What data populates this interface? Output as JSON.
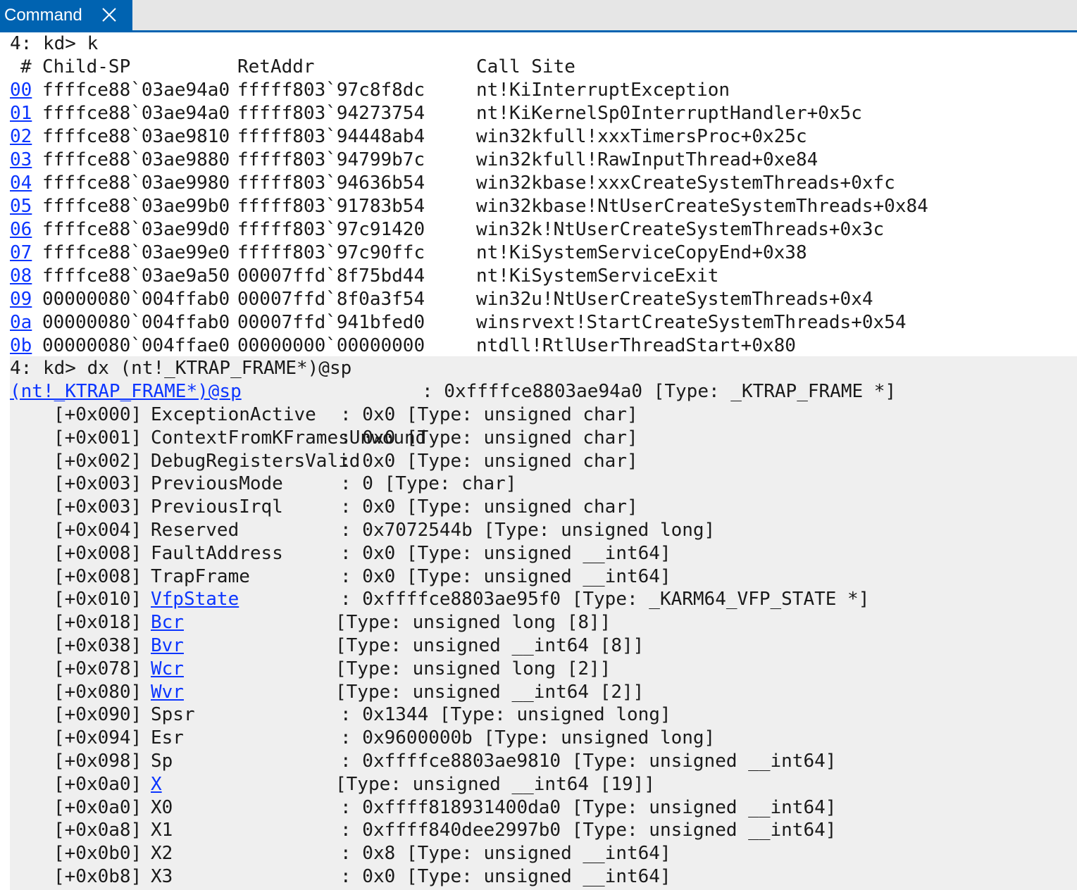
{
  "tab": {
    "label": "Command",
    "close_icon": "close-icon"
  },
  "stack": {
    "prompt": "4: kd> k",
    "headers": {
      "num": "#",
      "child_sp": "Child-SP",
      "ret_addr": "RetAddr",
      "call_site": "Call Site"
    },
    "frames": [
      {
        "num": "00",
        "child_sp": "ffffce88`03ae94a0",
        "ret_addr": "fffff803`97c8f8dc",
        "call_site": "nt!KiInterruptException"
      },
      {
        "num": "01",
        "child_sp": "ffffce88`03ae94a0",
        "ret_addr": "fffff803`94273754",
        "call_site": "nt!KiKernelSp0InterruptHandler+0x5c"
      },
      {
        "num": "02",
        "child_sp": "ffffce88`03ae9810",
        "ret_addr": "fffff803`94448ab4",
        "call_site": "win32kfull!xxxTimersProc+0x25c"
      },
      {
        "num": "03",
        "child_sp": "ffffce88`03ae9880",
        "ret_addr": "fffff803`94799b7c",
        "call_site": "win32kfull!RawInputThread+0xe84"
      },
      {
        "num": "04",
        "child_sp": "ffffce88`03ae9980",
        "ret_addr": "fffff803`94636b54",
        "call_site": "win32kbase!xxxCreateSystemThreads+0xfc"
      },
      {
        "num": "05",
        "child_sp": "ffffce88`03ae99b0",
        "ret_addr": "fffff803`91783b54",
        "call_site": "win32kbase!NtUserCreateSystemThreads+0x84"
      },
      {
        "num": "06",
        "child_sp": "ffffce88`03ae99d0",
        "ret_addr": "fffff803`97c91420",
        "call_site": "win32k!NtUserCreateSystemThreads+0x3c"
      },
      {
        "num": "07",
        "child_sp": "ffffce88`03ae99e0",
        "ret_addr": "fffff803`97c90ffc",
        "call_site": "nt!KiSystemServiceCopyEnd+0x38"
      },
      {
        "num": "08",
        "child_sp": "ffffce88`03ae9a50",
        "ret_addr": "00007ffd`8f75bd44",
        "call_site": "nt!KiSystemServiceExit"
      },
      {
        "num": "09",
        "child_sp": "00000080`004ffab0",
        "ret_addr": "00007ffd`8f0a3f54",
        "call_site": "win32u!NtUserCreateSystemThreads+0x4"
      },
      {
        "num": "0a",
        "child_sp": "00000080`004ffab0",
        "ret_addr": "00007ffd`941bfed0",
        "call_site": "winsrvext!StartCreateSystemThreads+0x54"
      },
      {
        "num": "0b",
        "child_sp": "00000080`004ffae0",
        "ret_addr": "00000000`00000000",
        "call_site": "ntdll!RtlUserThreadStart+0x80"
      }
    ]
  },
  "dx": {
    "prompt": "4: kd> dx (nt!_KTRAP_FRAME*)@sp",
    "root": {
      "expr": "(nt!_KTRAP_FRAME*)@sp",
      "value": ": 0xffffce8803ae94a0 [Type: _KTRAP_FRAME *]"
    },
    "fields": [
      {
        "offset": "[+0x000]",
        "name": "ExceptionActive",
        "link": false,
        "value": ": 0x0 [Type: unsigned char]"
      },
      {
        "offset": "[+0x001]",
        "name": "ContextFromKFramesUnwound",
        "link": false,
        "value": ": 0x0 [Type: unsigned char]"
      },
      {
        "offset": "[+0x002]",
        "name": "DebugRegistersValid",
        "link": false,
        "value": ": 0x0 [Type: unsigned char]"
      },
      {
        "offset": "[+0x003]",
        "name": "PreviousMode",
        "link": false,
        "value": ": 0 [Type: char]"
      },
      {
        "offset": "[+0x003]",
        "name": "PreviousIrql",
        "link": false,
        "value": ": 0x0 [Type: unsigned char]"
      },
      {
        "offset": "[+0x004]",
        "name": "Reserved",
        "link": false,
        "value": ": 0x7072544b [Type: unsigned long]"
      },
      {
        "offset": "[+0x008]",
        "name": "FaultAddress",
        "link": false,
        "value": ": 0x0 [Type: unsigned __int64]"
      },
      {
        "offset": "[+0x008]",
        "name": "TrapFrame",
        "link": false,
        "value": ": 0x0 [Type: unsigned __int64]"
      },
      {
        "offset": "[+0x010]",
        "name": "VfpState",
        "link": true,
        "value": ": 0xffffce8803ae95f0 [Type: _KARM64_VFP_STATE *]"
      },
      {
        "offset": "[+0x018]",
        "name": "Bcr",
        "link": true,
        "value": "[Type: unsigned long [8]]"
      },
      {
        "offset": "[+0x038]",
        "name": "Bvr",
        "link": true,
        "value": "[Type: unsigned __int64 [8]]"
      },
      {
        "offset": "[+0x078]",
        "name": "Wcr",
        "link": true,
        "value": "[Type: unsigned long [2]]"
      },
      {
        "offset": "[+0x080]",
        "name": "Wvr",
        "link": true,
        "value": "[Type: unsigned __int64 [2]]"
      },
      {
        "offset": "[+0x090]",
        "name": "Spsr",
        "link": false,
        "value": ": 0x1344 [Type: unsigned long]"
      },
      {
        "offset": "[+0x094]",
        "name": "Esr",
        "link": false,
        "value": ": 0x9600000b [Type: unsigned long]"
      },
      {
        "offset": "[+0x098]",
        "name": "Sp",
        "link": false,
        "value": ": 0xffffce8803ae9810 [Type: unsigned __int64]"
      },
      {
        "offset": "[+0x0a0]",
        "name": "X",
        "link": true,
        "value": "[Type: unsigned __int64 [19]]"
      },
      {
        "offset": "[+0x0a0]",
        "name": "X0",
        "link": false,
        "value": ": 0xffff818931400da0 [Type: unsigned __int64]"
      },
      {
        "offset": "[+0x0a8]",
        "name": "X1",
        "link": false,
        "value": ": 0xffff840dee2997b0 [Type: unsigned __int64]"
      },
      {
        "offset": "[+0x0b0]",
        "name": "X2",
        "link": false,
        "value": ": 0x8 [Type: unsigned __int64]"
      },
      {
        "offset": "[+0x0b8]",
        "name": "X3",
        "link": false,
        "value": ": 0x0 [Type: unsigned __int64]"
      }
    ]
  },
  "colors": {
    "accent": "#0063b1",
    "link": "#0b35ff",
    "shade": "#efefef",
    "text": "#1a1a1a"
  }
}
